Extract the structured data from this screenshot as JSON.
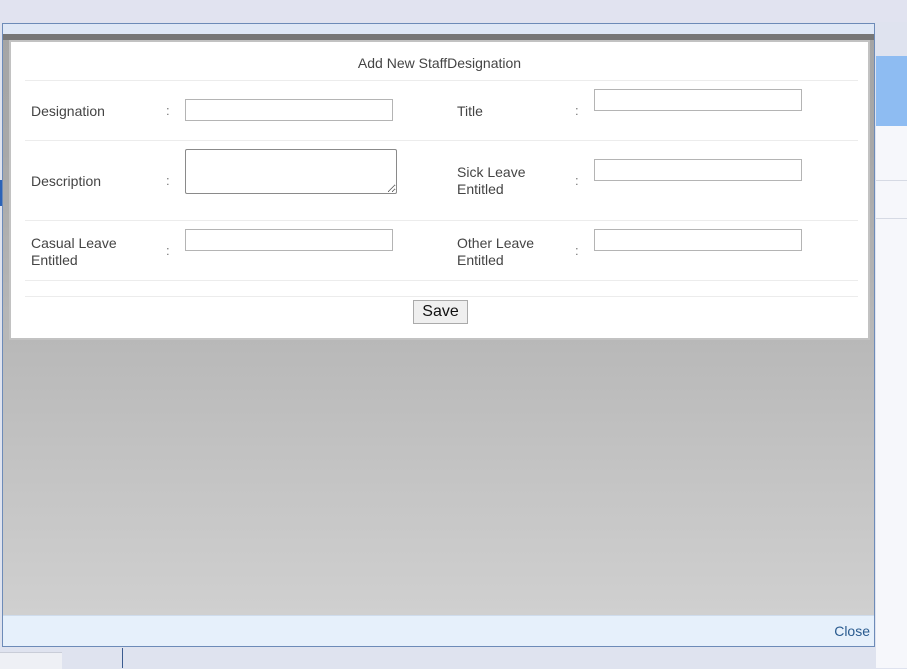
{
  "dialog": {
    "title": "Add New StaffDesignation",
    "close_label": "Close"
  },
  "form": {
    "colon": ":",
    "designation": {
      "label": "Designation",
      "value": ""
    },
    "title": {
      "label": "Title",
      "value": ""
    },
    "description": {
      "label": "Description",
      "value": ""
    },
    "sick_leave": {
      "label_line1": "Sick Leave",
      "label_line2": "Entitled",
      "value": ""
    },
    "casual_leave": {
      "label_line1": "Casual Leave",
      "label_line2": "Entitled",
      "value": ""
    },
    "other_leave": {
      "label_line1": "Other Leave",
      "label_line2": "Entitled",
      "value": ""
    },
    "save_label": "Save"
  }
}
